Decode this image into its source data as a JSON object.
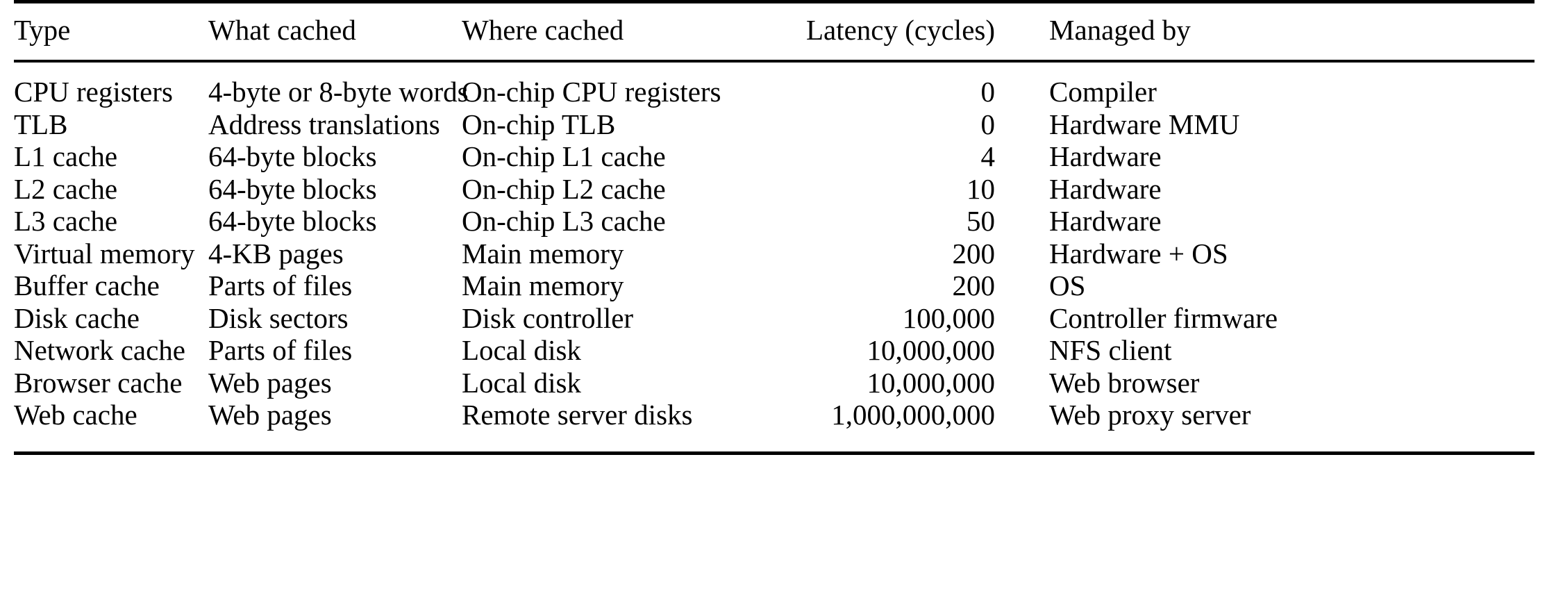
{
  "table": {
    "columns": [
      {
        "key": "type",
        "label": "Type",
        "align": "left"
      },
      {
        "key": "what",
        "label": "What cached",
        "align": "left"
      },
      {
        "key": "where",
        "label": "Where cached",
        "align": "left"
      },
      {
        "key": "latency",
        "label": "Latency (cycles)",
        "align": "right"
      },
      {
        "key": "managed",
        "label": "Managed by",
        "align": "left"
      }
    ],
    "header": {
      "type": "Type",
      "what": "What cached",
      "where": "Where cached",
      "latency": "Latency (cycles)",
      "managed": "Managed by"
    },
    "rows": [
      {
        "type": "CPU registers",
        "what": "4-byte or 8-byte words",
        "where": "On-chip CPU registers",
        "latency": "0",
        "managed": "Compiler"
      },
      {
        "type": "TLB",
        "what": "Address translations",
        "where": "On-chip TLB",
        "latency": "0",
        "managed": "Hardware MMU"
      },
      {
        "type": "L1 cache",
        "what": "64-byte blocks",
        "where": "On-chip L1 cache",
        "latency": "4",
        "managed": "Hardware"
      },
      {
        "type": "L2 cache",
        "what": "64-byte blocks",
        "where": "On-chip L2 cache",
        "latency": "10",
        "managed": "Hardware"
      },
      {
        "type": "L3 cache",
        "what": "64-byte blocks",
        "where": "On-chip L3 cache",
        "latency": "50",
        "managed": "Hardware"
      },
      {
        "type": "Virtual memory",
        "what": "4-KB pages",
        "where": "Main memory",
        "latency": "200",
        "managed": "Hardware + OS"
      },
      {
        "type": "Buffer cache",
        "what": "Parts of files",
        "where": "Main memory",
        "latency": "200",
        "managed": "OS"
      },
      {
        "type": "Disk cache",
        "what": "Disk sectors",
        "where": "Disk controller",
        "latency": "100,000",
        "managed": "Controller firmware"
      },
      {
        "type": "Network cache",
        "what": "Parts of files",
        "where": "Local disk",
        "latency": "10,000,000",
        "managed": "NFS client"
      },
      {
        "type": "Browser cache",
        "what": "Web pages",
        "where": "Local disk",
        "latency": "10,000,000",
        "managed": "Web browser"
      },
      {
        "type": "Web cache",
        "what": "Web pages",
        "where": "Remote server disks",
        "latency": "1,000,000,000",
        "managed": "Web proxy server"
      }
    ]
  }
}
